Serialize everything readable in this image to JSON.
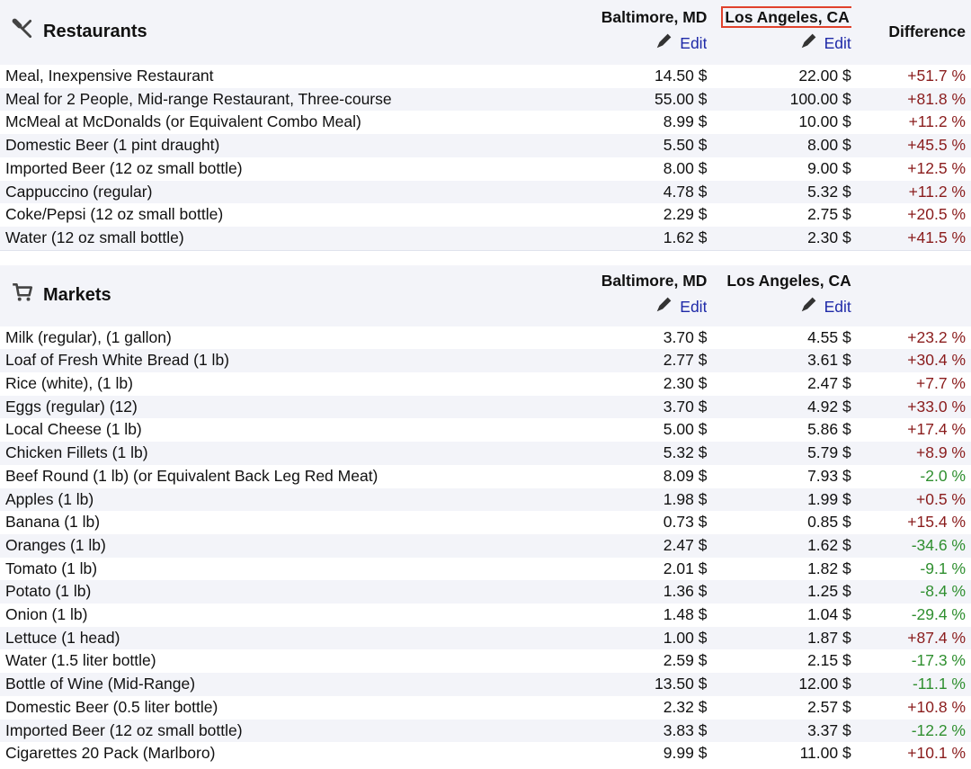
{
  "restaurants": {
    "title": "Restaurants",
    "city_a": "Baltimore, MD",
    "city_b": "Los Angeles, CA",
    "edit_label": "Edit",
    "difference_label": "Difference",
    "rows": [
      {
        "name": "Meal, Inexpensive Restaurant",
        "a": "14.50 $",
        "b": "22.00 $",
        "diff": "+51.7 %",
        "trend": "pos"
      },
      {
        "name": "Meal for 2 People, Mid-range Restaurant, Three-course",
        "a": "55.00 $",
        "b": "100.00 $",
        "diff": "+81.8 %",
        "trend": "pos"
      },
      {
        "name": "McMeal at McDonalds (or Equivalent Combo Meal)",
        "a": "8.99 $",
        "b": "10.00 $",
        "diff": "+11.2 %",
        "trend": "pos"
      },
      {
        "name": "Domestic Beer (1 pint draught)",
        "a": "5.50 $",
        "b": "8.00 $",
        "diff": "+45.5 %",
        "trend": "pos"
      },
      {
        "name": "Imported Beer (12 oz small bottle)",
        "a": "8.00 $",
        "b": "9.00 $",
        "diff": "+12.5 %",
        "trend": "pos"
      },
      {
        "name": "Cappuccino (regular)",
        "a": "4.78 $",
        "b": "5.32 $",
        "diff": "+11.2 %",
        "trend": "pos"
      },
      {
        "name": "Coke/Pepsi (12 oz small bottle)",
        "a": "2.29 $",
        "b": "2.75 $",
        "diff": "+20.5 %",
        "trend": "pos"
      },
      {
        "name": "Water (12 oz small bottle)",
        "a": "1.62 $",
        "b": "2.30 $",
        "diff": "+41.5 %",
        "trend": "pos"
      }
    ]
  },
  "markets": {
    "title": "Markets",
    "city_a": "Baltimore, MD",
    "city_b": "Los Angeles, CA",
    "edit_label": "Edit",
    "rows": [
      {
        "name": "Milk (regular), (1 gallon)",
        "a": "3.70 $",
        "b": "4.55 $",
        "diff": "+23.2 %",
        "trend": "pos"
      },
      {
        "name": "Loaf of Fresh White Bread (1 lb)",
        "a": "2.77 $",
        "b": "3.61 $",
        "diff": "+30.4 %",
        "trend": "pos"
      },
      {
        "name": "Rice (white), (1 lb)",
        "a": "2.30 $",
        "b": "2.47 $",
        "diff": "+7.7 %",
        "trend": "pos"
      },
      {
        "name": "Eggs (regular) (12)",
        "a": "3.70 $",
        "b": "4.92 $",
        "diff": "+33.0 %",
        "trend": "pos"
      },
      {
        "name": "Local Cheese (1 lb)",
        "a": "5.00 $",
        "b": "5.86 $",
        "diff": "+17.4 %",
        "trend": "pos"
      },
      {
        "name": "Chicken Fillets (1 lb)",
        "a": "5.32 $",
        "b": "5.79 $",
        "diff": "+8.9 %",
        "trend": "pos"
      },
      {
        "name": "Beef Round (1 lb) (or Equivalent Back Leg Red Meat)",
        "a": "8.09 $",
        "b": "7.93 $",
        "diff": "-2.0 %",
        "trend": "neg"
      },
      {
        "name": "Apples (1 lb)",
        "a": "1.98 $",
        "b": "1.99 $",
        "diff": "+0.5 %",
        "trend": "pos"
      },
      {
        "name": "Banana (1 lb)",
        "a": "0.73 $",
        "b": "0.85 $",
        "diff": "+15.4 %",
        "trend": "pos"
      },
      {
        "name": "Oranges (1 lb)",
        "a": "2.47 $",
        "b": "1.62 $",
        "diff": "-34.6 %",
        "trend": "neg"
      },
      {
        "name": "Tomato (1 lb)",
        "a": "2.01 $",
        "b": "1.82 $",
        "diff": "-9.1 %",
        "trend": "neg"
      },
      {
        "name": "Potato (1 lb)",
        "a": "1.36 $",
        "b": "1.25 $",
        "diff": "-8.4 %",
        "trend": "neg"
      },
      {
        "name": "Onion (1 lb)",
        "a": "1.48 $",
        "b": "1.04 $",
        "diff": "-29.4 %",
        "trend": "neg"
      },
      {
        "name": "Lettuce (1 head)",
        "a": "1.00 $",
        "b": "1.87 $",
        "diff": "+87.4 %",
        "trend": "pos"
      },
      {
        "name": "Water (1.5 liter bottle)",
        "a": "2.59 $",
        "b": "2.15 $",
        "diff": "-17.3 %",
        "trend": "neg"
      },
      {
        "name": "Bottle of Wine (Mid-Range)",
        "a": "13.50 $",
        "b": "12.00 $",
        "diff": "-11.1 %",
        "trend": "neg"
      },
      {
        "name": "Domestic Beer (0.5 liter bottle)",
        "a": "2.32 $",
        "b": "2.57 $",
        "diff": "+10.8 %",
        "trend": "pos"
      },
      {
        "name": "Imported Beer (12 oz small bottle)",
        "a": "3.83 $",
        "b": "3.37 $",
        "diff": "-12.2 %",
        "trend": "neg"
      },
      {
        "name": "Cigarettes 20 Pack (Marlboro)",
        "a": "9.99 $",
        "b": "11.00 $",
        "diff": "+10.1 %",
        "trend": "pos"
      }
    ]
  },
  "colors": {
    "positive": "#8a1c1c",
    "negative": "#2f8f2f",
    "edit_link": "#1f2aa8",
    "highlight": "#e0412c",
    "header_bg": "#f3f4f9"
  },
  "icons": {
    "restaurants": "fork-knife-icon",
    "markets": "cart-icon",
    "edit": "pencil-icon"
  }
}
